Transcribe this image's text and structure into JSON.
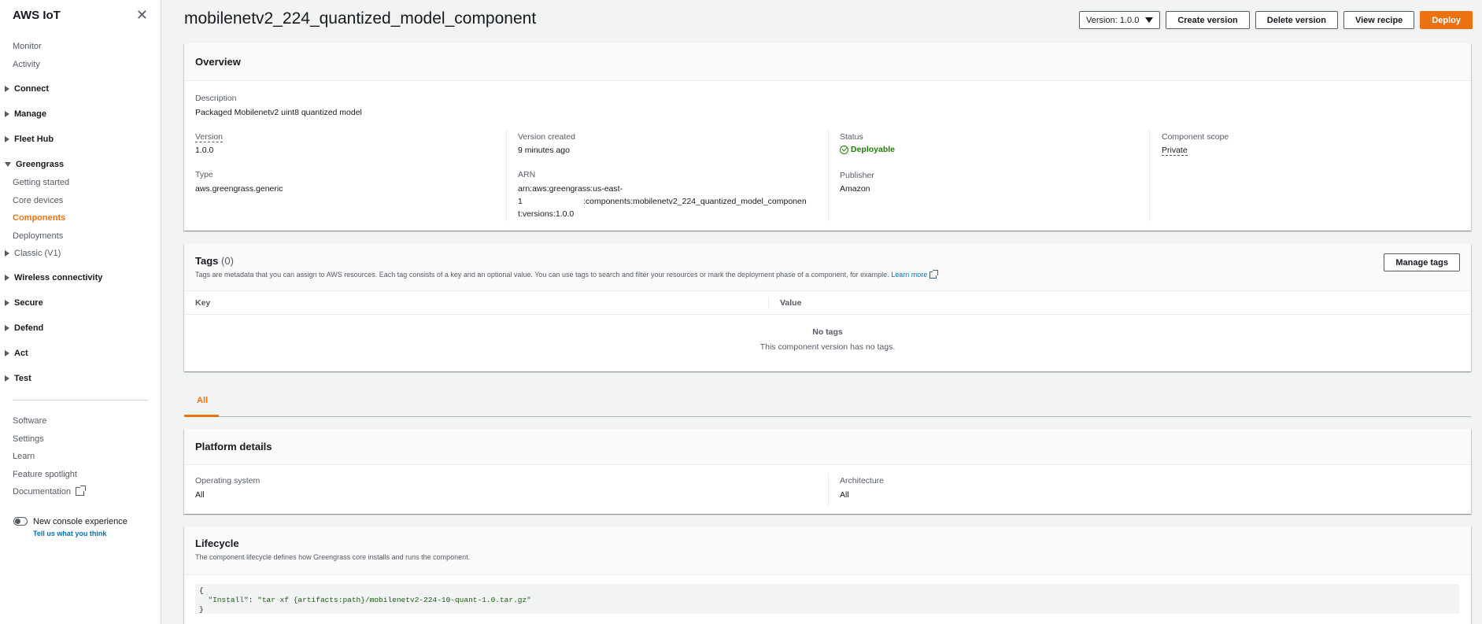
{
  "sidebar": {
    "title": "AWS IoT",
    "items": {
      "monitor": "Monitor",
      "activity": "Activity",
      "connect": "Connect",
      "manage": "Manage",
      "fleet_hub": "Fleet Hub",
      "greengrass": "Greengrass",
      "getting_started": "Getting started",
      "core_devices": "Core devices",
      "components": "Components",
      "deployments": "Deployments",
      "classic": "Classic (V1)",
      "wireless": "Wireless connectivity",
      "secure": "Secure",
      "defend": "Defend",
      "act": "Act",
      "test": "Test",
      "software": "Software",
      "settings": "Settings",
      "learn": "Learn",
      "feature_spotlight": "Feature spotlight",
      "documentation": "Documentation"
    },
    "toggle_label": "New console experience",
    "feedback_link": "Tell us what you think"
  },
  "header": {
    "title": "mobilenetv2_224_quantized_model_component",
    "version_select": "Version: 1.0.0",
    "create_version": "Create version",
    "delete_version": "Delete version",
    "view_recipe": "View recipe",
    "deploy": "Deploy"
  },
  "overview": {
    "title": "Overview",
    "description_label": "Description",
    "description_value": "Packaged Mobilenetv2 uint8 quantized model",
    "version_label": "Version",
    "version_value": "1.0.0",
    "type_label": "Type",
    "type_value": "aws.greengrass.generic",
    "version_created_label": "Version created",
    "version_created_value": "9 minutes ago",
    "arn_label": "ARN",
    "arn_line1": "arn:aws:greengrass:us-east-",
    "arn_line2a": "1",
    "arn_line2b": ":components:mobilenetv2_224_quantized_model_componen",
    "arn_line3": "t:versions:1.0.0",
    "status_label": "Status",
    "status_value": "Deployable",
    "publisher_label": "Publisher",
    "publisher_value": "Amazon",
    "scope_label": "Component scope",
    "scope_value": "Private"
  },
  "tags": {
    "title": "Tags",
    "count": "(0)",
    "description": "Tags are metadata that you can assign to AWS resources. Each tag consists of a key and an optional value. You can use tags to search and filter your resources or mark the deployment phase of a component, for example.",
    "learn_more": "Learn more",
    "manage_button": "Manage tags",
    "col_key": "Key",
    "col_value": "Value",
    "empty_title": "No tags",
    "empty_desc": "This component version has no tags."
  },
  "tabs": {
    "all": "All"
  },
  "platform": {
    "title": "Platform details",
    "os_label": "Operating system",
    "os_value": "All",
    "arch_label": "Architecture",
    "arch_value": "All"
  },
  "lifecycle": {
    "title": "Lifecycle",
    "description": "The component lifecycle defines how Greengrass core installs and runs the component.",
    "code_open": "{",
    "code_key": "  \"Install\"",
    "code_sep": ": ",
    "code_value": "\"tar xf {artifacts:path}/mobilenetv2-224-10-quant-1.0.tar.gz\"",
    "code_close": "}"
  }
}
